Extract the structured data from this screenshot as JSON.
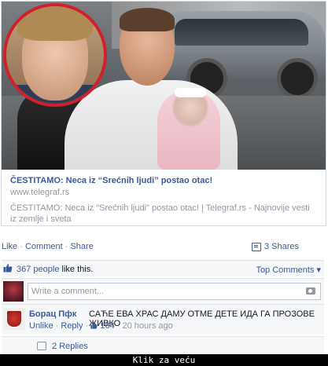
{
  "link_preview": {
    "title": "ČESTITAMO: Neca iz “Srećnih ljudi” postao otac!",
    "url": "www.telegraf.rs",
    "description": "ČESTITAMO: Neca iz \"Srećnih ljudi\" postao otac! | Telegraf.rs - Najnovije vesti iz zemlje i sveta"
  },
  "actions": {
    "like": "Like",
    "comment": "Comment",
    "share": "Share",
    "separator": "·",
    "shares_count": "3 Shares"
  },
  "likes": {
    "count_link": "367 people",
    "suffix": " like this.",
    "top_comments": "Top Comments ▾"
  },
  "compose": {
    "placeholder": "Write a comment..."
  },
  "comment": {
    "author": "Борац Пфк",
    "text": "САЋЕ ЕВА ХРАС ДАМУ ОТМЕ ДЕТЕ ИДА ГА ПРОЗОВЕ ЖИВКО",
    "unlike": "Unlike",
    "reply": "Reply",
    "separator": "·",
    "likes": "164",
    "time": "20 hours ago"
  },
  "replies": {
    "label": "2 Replies"
  },
  "footer": {
    "text": "Klik za veću"
  },
  "colors": {
    "link": "#3b5998",
    "muted": "#9197a3",
    "inset_border": "#d0202b"
  }
}
